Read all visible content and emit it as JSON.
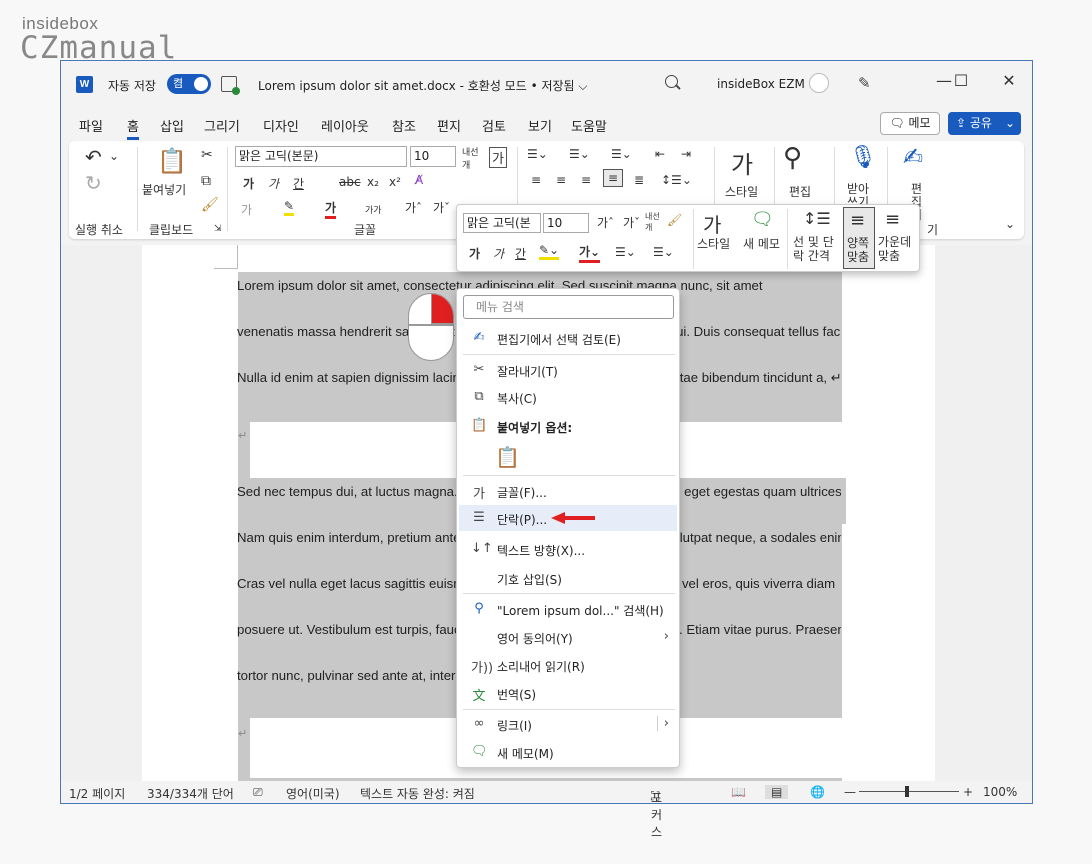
{
  "watermark": {
    "line1": "insidebox",
    "line2": "CZmanual"
  },
  "titlebar": {
    "app_icon": "W",
    "autosave_label": "자동 저장",
    "autosave_state": "켬",
    "document_title": "Lorem ipsum dolor sit amet.docx  -  호환성 모드 • 저장됨 ⌵",
    "user_name": "insideBox EZM",
    "minimize": "—",
    "maximize": "☐",
    "close": "✕"
  },
  "tabs": [
    "파일",
    "홈",
    "삽입",
    "그리기",
    "디자인",
    "레이아웃",
    "참조",
    "편지",
    "검토",
    "보기",
    "도움말"
  ],
  "active_tab": "홈",
  "header_buttons": {
    "memo": "메모",
    "share": "공유"
  },
  "ribbon": {
    "groups": {
      "undo": "실행 취소",
      "clipboard": "클립보드",
      "font": "글꼴",
      "editing_partial": "기"
    },
    "paste_label": "붙여넣기",
    "font_name": "맑은 고딕(본문)",
    "font_size": "10",
    "style_label": "스타일",
    "edit_label": "편집",
    "dictate_label": "받아쓰기",
    "editor_label": "편집기"
  },
  "mini_toolbar": {
    "font_name": "맑은 고딕(본",
    "font_size": "10",
    "style": "스타일",
    "new_memo": "새 메모",
    "line_spacing": "선 및 단락 간격",
    "justify": "양쪽 맞춤",
    "center": "가운데 맞춤"
  },
  "document": {
    "lines": [
      "Lorem ipsum dolor sit amet, consectetur adipiscing elit. Sed suscipit magna nunc, sit amet",
      "venenatis massa hendrerit sapien. Ut in turpis sed nibh mattis varius et at dui. Duis consequat tellus facilisis.",
      "Nulla id enim at sapien dignissim lacinia. Aliquam tempor placerat mauris, vitae bibendum tincidunt a, ↵",
      "Sed nec tempus dui, at luctus magna. Nullam semper lorem ac nisi sodales, eget egestas quam ultrices eget.",
      "Nam quis enim interdum, pretium ante vel, facilisis turpis. Donec aliquam volutpat neque, a sodales enim.",
      "Cras vel nulla eget lacus sagittis euismod vel eu nibh. Quisque lobortis ante vel eros, quis viverra diam",
      "posuere ut. Vestibulum est turpis, faucibus ac mattis vitae, ornare eget nulla. Etiam vitae purus. Praesent",
      "tortor nunc, pulvinar sed ante at, interdum aliquet odio."
    ],
    "paragraph_mark": "↵"
  },
  "context_menu": {
    "search_placeholder": "메뉴 검색",
    "items": [
      {
        "label": "편집기에서 선택 검토(E)",
        "icon": "editor-pen-icon"
      },
      {
        "label": "잘라내기(T)",
        "icon": "scissors-icon"
      },
      {
        "label": "복사(C)",
        "icon": "copy-icon"
      },
      {
        "label": "붙여넣기 옵션:",
        "icon": "paste-icon"
      },
      {
        "label": "글꼴(F)...",
        "icon": "font-icon"
      },
      {
        "label": "단락(P)...",
        "icon": "paragraph-icon"
      },
      {
        "label": "텍스트 방향(X)...",
        "icon": "text-direction-icon"
      },
      {
        "label": "기호 삽입(S)",
        "icon": ""
      },
      {
        "label": "\"Lorem ipsum dol...\" 검색(H)",
        "icon": "search-icon"
      },
      {
        "label": "영어 동의어(Y)",
        "icon": ""
      },
      {
        "label": "소리내어 읽기(R)",
        "icon": "read-aloud-icon"
      },
      {
        "label": "번역(S)",
        "icon": "translate-icon"
      },
      {
        "label": "링크(I)",
        "icon": "link-icon"
      },
      {
        "label": "새 메모(M)",
        "icon": "new-comment-icon"
      }
    ],
    "highlighted": "단락(P)..."
  },
  "statusbar": {
    "page": "1/2 페이지",
    "words": "334/334개 단어",
    "language": "영어(미국)",
    "autocomplete": "텍스트 자동 완성: 켜짐",
    "focus": "포커스",
    "zoom": "100%",
    "zoom_minus": "—",
    "zoom_plus": "+"
  },
  "colors": {
    "accent": "#185abd",
    "selection": "#c8c8c8",
    "highlight_row": "#e6edf8",
    "arrow": "#e02020"
  }
}
